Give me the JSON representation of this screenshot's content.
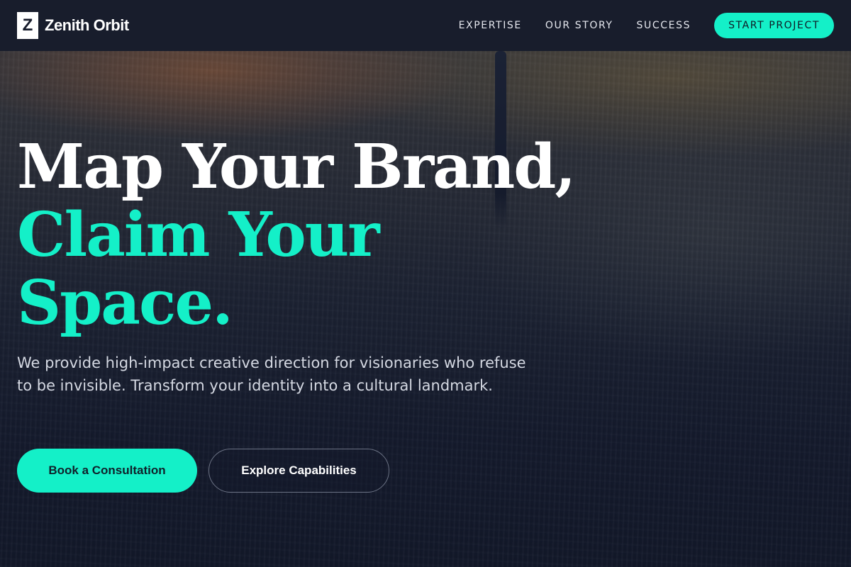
{
  "brand": {
    "mark": "Z",
    "name": "Zenith Orbit"
  },
  "nav": {
    "links": [
      "EXPERTISE",
      "OUR STORY",
      "SUCCESS"
    ],
    "cta_label": "START PROJECT"
  },
  "hero": {
    "headline_line1": "Map Your Brand,",
    "headline_line2": "Claim Your",
    "headline_line3": "Space.",
    "subtitle": "We provide high-impact creative direction for visionaries who refuse to be invisible. Transform your identity into a cultural landmark.",
    "primary_button": "Book a Consultation",
    "secondary_button": "Explore Capabilities"
  },
  "colors": {
    "accent": "#14f0c8",
    "background": "#141a2c",
    "header": "#181d2c"
  }
}
